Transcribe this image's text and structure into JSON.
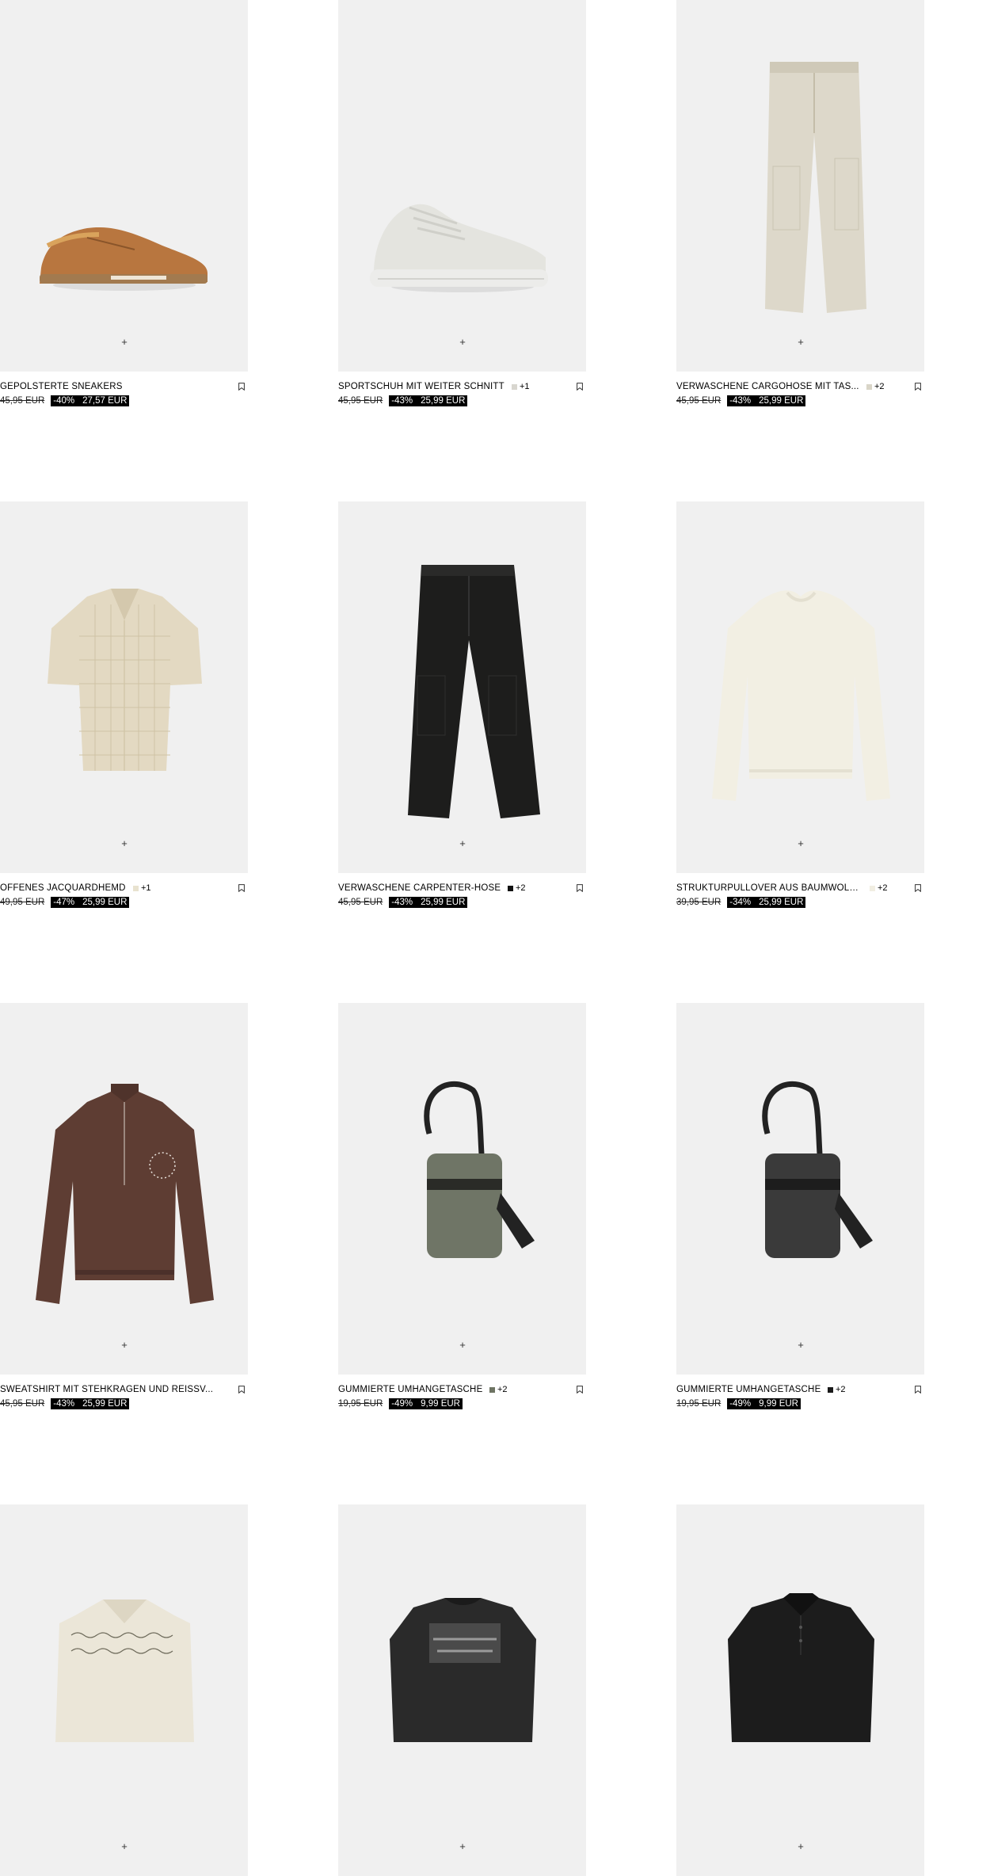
{
  "add_symbol": "+",
  "products": [
    {
      "name": "GEPOLSTERTE SNEAKERS",
      "swatch_color": "",
      "swatch_count": "",
      "old_price": "45,95 EUR",
      "discount": "-40%",
      "price": "27,57 EUR",
      "icon": "sneaker-brown"
    },
    {
      "name": "SPORTSCHUH MIT WEITER SCHNITT",
      "swatch_color": "#d8d6cf",
      "swatch_count": "+1",
      "old_price": "45,95 EUR",
      "discount": "-43%",
      "price": "25,99 EUR",
      "icon": "sneaker-white"
    },
    {
      "name": "VERWASCHENE CARGOHOSE MIT TAS...",
      "swatch_color": "#d9d5c8",
      "swatch_count": "+2",
      "old_price": "45,95 EUR",
      "discount": "-43%",
      "price": "25,99 EUR",
      "icon": "pants-beige"
    },
    {
      "name": "OFFENES JACQUARDHEMD",
      "swatch_color": "#e8e2cf",
      "swatch_count": "+1",
      "old_price": "49,95 EUR",
      "discount": "-47%",
      "price": "25,99 EUR",
      "icon": "shirt-beige"
    },
    {
      "name": "VERWASCHENE CARPENTER-HOSE",
      "swatch_color": "#111111",
      "swatch_count": "+2",
      "old_price": "45,95 EUR",
      "discount": "-43%",
      "price": "25,99 EUR",
      "icon": "pants-black"
    },
    {
      "name": "STRUKTURPULLOVER AUS BAUMWOLL...",
      "swatch_color": "#f1eee2",
      "swatch_count": "+2",
      "old_price": "39,95 EUR",
      "discount": "-34%",
      "price": "25,99 EUR",
      "icon": "sweater-cream"
    },
    {
      "name": "SWEATSHIRT MIT STEHKRAGEN UND REISSV...",
      "swatch_color": "",
      "swatch_count": "",
      "old_price": "45,95 EUR",
      "discount": "-43%",
      "price": "25,99 EUR",
      "icon": "sweatshirt-brown"
    },
    {
      "name": "GUMMIERTE UMHÄNGETASCHE",
      "swatch_color": "#6e7463",
      "swatch_count": "+2",
      "old_price": "19,95 EUR",
      "discount": "-49%",
      "price": "9,99 EUR",
      "icon": "bag-green"
    },
    {
      "name": "GUMMIERTE UMHÄNGETASCHE",
      "swatch_color": "#1a1a1a",
      "swatch_count": "+2",
      "old_price": "19,95 EUR",
      "discount": "-49%",
      "price": "9,99 EUR",
      "icon": "bag-black"
    },
    {
      "name": "",
      "swatch_color": "",
      "swatch_count": "",
      "old_price": "",
      "discount": "",
      "price": "",
      "icon": "shirt-pattern"
    },
    {
      "name": "",
      "swatch_color": "",
      "swatch_count": "",
      "old_price": "",
      "discount": "",
      "price": "",
      "icon": "tshirt-black-print"
    },
    {
      "name": "",
      "swatch_color": "",
      "swatch_count": "",
      "old_price": "",
      "discount": "",
      "price": "",
      "icon": "polo-black"
    }
  ]
}
